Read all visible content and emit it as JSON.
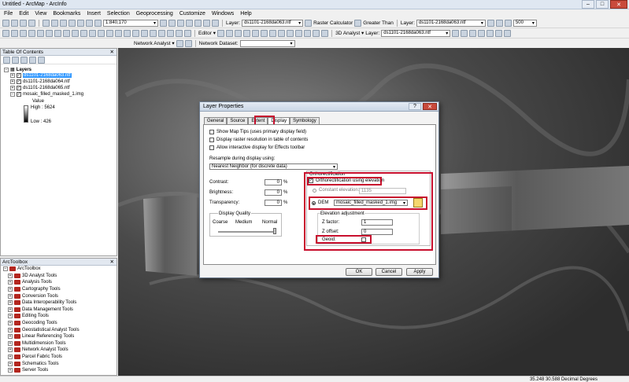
{
  "window": {
    "title": "Untitled - ArcMap - ArcInfo",
    "min_label": "–",
    "max_label": "□",
    "close_label": "✕"
  },
  "menu": [
    "File",
    "Edit",
    "View",
    "Bookmarks",
    "Insert",
    "Selection",
    "Geoprocessing",
    "Customize",
    "Windows",
    "Help"
  ],
  "toolbar": {
    "scale": "1:840,170",
    "editor_label": "Editor ▾",
    "layer_label": "Layer:",
    "layer_value": "ds1101-2168da063.ntf",
    "raster_calculator": "Raster Calculator",
    "greater_than": "Greater Than",
    "layer2_label": "Layer:",
    "layer2_value": "ds1101-2168da063.ntf",
    "zoom_value": "500",
    "analyst_3d": "3D Analyst ▾",
    "layer3_label": "Layer:",
    "layer3_value": "ds1101-2168da063.ntf",
    "network_analyst": "Network Analyst ▾",
    "network_dataset": "Network Dataset:"
  },
  "toc": {
    "title": "Table Of Contents",
    "root": "Layers",
    "layers": [
      "ds1101-2168da063.ntf",
      "ds1101-2168da064.ntf",
      "ds1101-2168da065.ntf",
      "mosaic_filled_masked_1.img"
    ],
    "value_label": "Value",
    "high_label": "High : 5624",
    "low_label": "Low : 426"
  },
  "arctoolbox": {
    "title": "ArcToolbox",
    "root": "ArcToolbox",
    "items": [
      "3D Analyst Tools",
      "Analysis Tools",
      "Cartography Tools",
      "Conversion Tools",
      "Data Interoperability Tools",
      "Data Management Tools",
      "Editing Tools",
      "Geocoding Tools",
      "Geostatistical Analyst Tools",
      "Linear Referencing Tools",
      "Multidimension Tools",
      "Network Analyst Tools",
      "Parcel Fabric Tools",
      "Schematics Tools",
      "Server Tools"
    ]
  },
  "status": {
    "coords": "35.248  30.588 Decimal Degrees"
  },
  "dialog": {
    "title": "Layer Properties",
    "help_btn": "?",
    "close_btn": "✕",
    "tabs": [
      "General",
      "Source",
      "Extent",
      "Display",
      "Symbology"
    ],
    "active_tab": "Display",
    "show_map_tips": "Show Map Tips (uses primary display field)",
    "display_resolution": "Display raster resolution in table of contents",
    "allow_effects": "Allow interactive display for Effects toolbar",
    "resample_label": "Resample during display using:",
    "resample_value": "Nearest Neighbor (for discrete data)",
    "contrast_label": "Contrast:",
    "contrast_value": "0",
    "brightness_label": "Brightness:",
    "brightness_value": "0",
    "transparency_label": "Transparency:",
    "transparency_value": "0",
    "percent": "%",
    "display_quality": "Display Quality",
    "coarse": "Coarse",
    "medium": "Medium",
    "normal": "Normal",
    "display_quality_level": 1.0,
    "ortho_group": "Orthorectification",
    "ortho_check": "Orthorectification using elevation",
    "constant_elev": "Constant elevation:",
    "constant_elev_value": "1135",
    "dem_label": "DEM",
    "dem_value": "mosaic_filled_masked_1.img",
    "elev_adjust": "Elevation adjustment",
    "zfactor_label": "Z factor:",
    "zfactor_value": "1",
    "zoffset_label": "Z offset:",
    "zoffset_value": "0",
    "geoid_label": "Geoid:",
    "ok": "OK",
    "cancel": "Cancel",
    "apply": "Apply"
  },
  "colors": {
    "highlight": "#c8102e",
    "selection": "#3399ff",
    "toolbox_icon": "#b3261e"
  }
}
